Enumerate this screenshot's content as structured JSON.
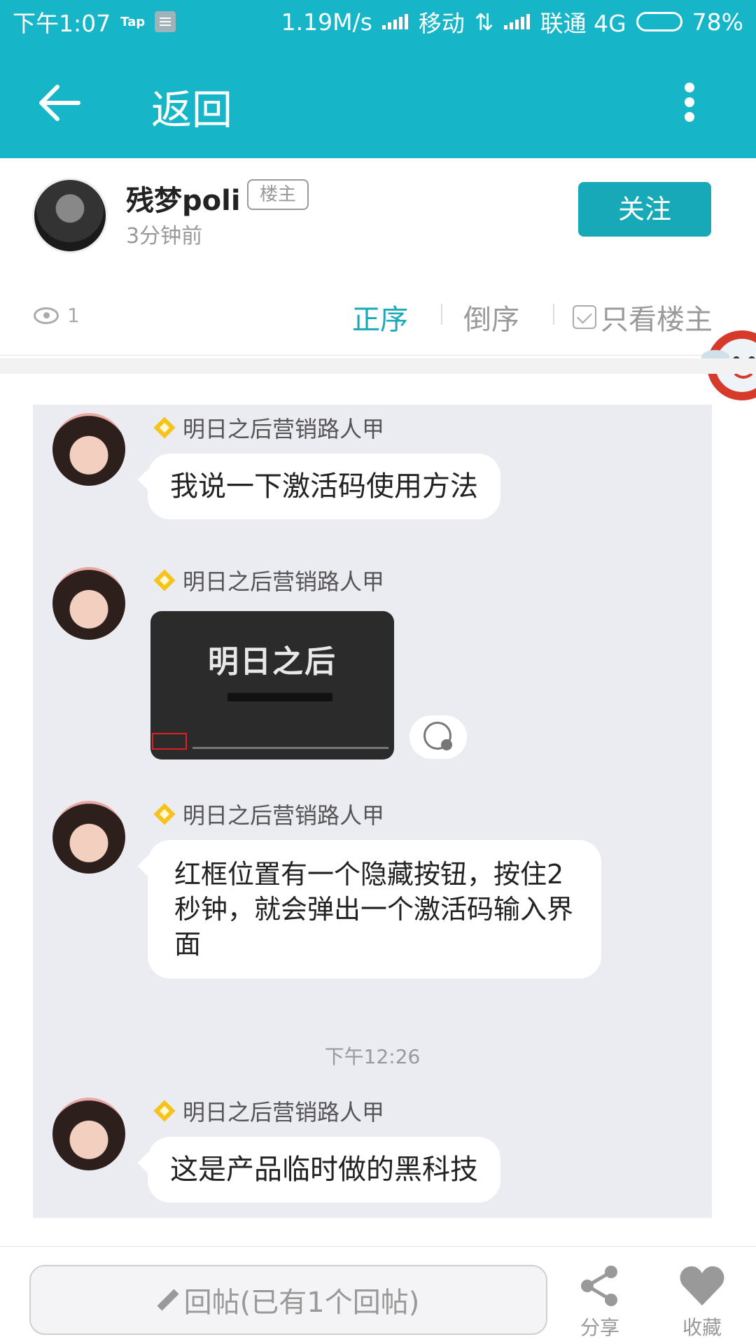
{
  "status_bar": {
    "time": "下午1:07",
    "app_tag": "Tap",
    "speed": "1.19M/s",
    "carrier1": "移动",
    "carrier2": "联通 4G",
    "battery": "78%",
    "battery_level": 0.78
  },
  "app_bar": {
    "back_icon": "arrow-left-icon",
    "title": "返回",
    "more_icon": "more-vertical-icon"
  },
  "author": {
    "name": "残梦poli",
    "badge": "楼主",
    "time": "3分钟前",
    "follow_label": "关注"
  },
  "filter": {
    "views": "1",
    "sort_asc": "正序",
    "sort_desc": "倒序",
    "only_owner": "只看楼主"
  },
  "chat": {
    "messages": [
      {
        "sender": "明日之后营销路人甲",
        "text": "我说一下激活码使用方法"
      },
      {
        "sender": "明日之后营销路人甲",
        "image_title": "明日之后"
      },
      {
        "sender": "明日之后营销路人甲",
        "text": "红框位置有一个隐藏按钮，按住2秒钟，就会弹出一个激活码输入界面"
      },
      {
        "sender": "明日之后营销路人甲",
        "text": "这是产品临时做的黑科技"
      }
    ],
    "time_divider": "下午12:26"
  },
  "bottom_bar": {
    "reply_placeholder": "回帖(已有1个回帖)",
    "share_label": "分享",
    "favorite_label": "收藏"
  },
  "colors": {
    "accent": "#16b5c7",
    "follow_button": "#17a9b8",
    "badge_gold": "#f6c21c"
  }
}
